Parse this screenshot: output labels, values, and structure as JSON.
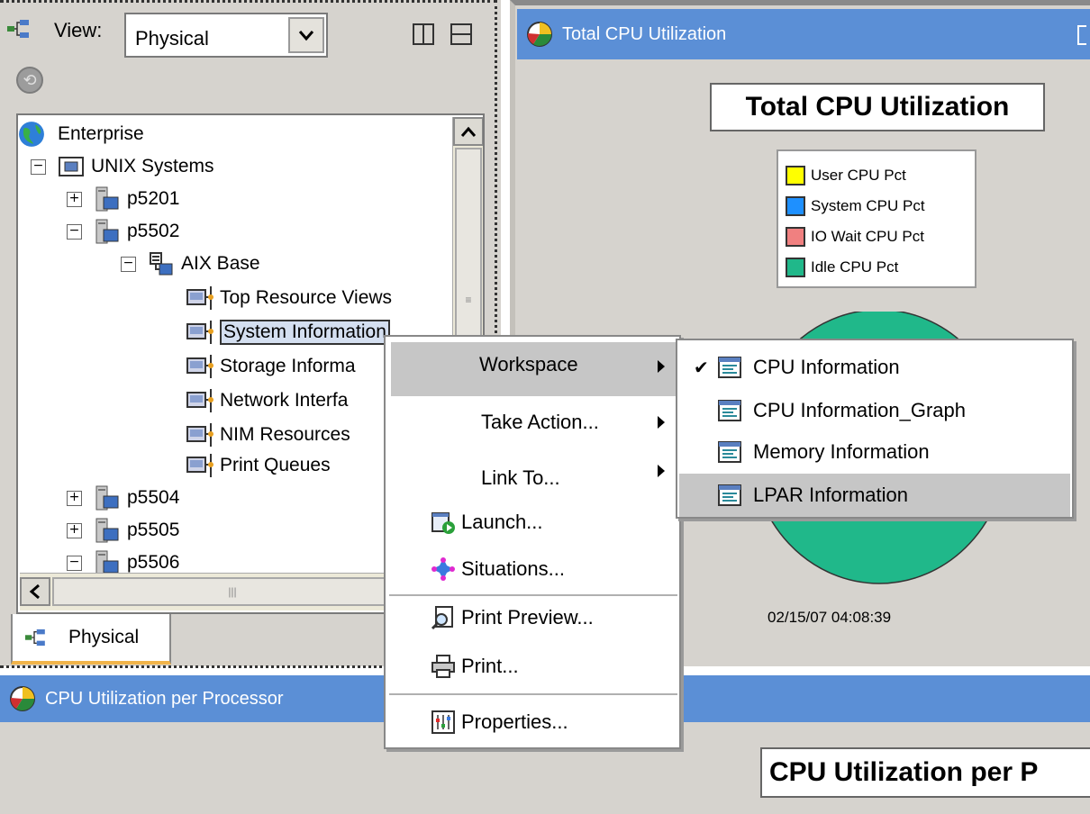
{
  "navigator": {
    "view_label": "View:",
    "view_select_value": "Physical",
    "tree": [
      {
        "label": "Enterprise",
        "icon": "globe-icon"
      },
      {
        "label": "UNIX Systems",
        "icon": "folder-icon",
        "expander": "⊟"
      },
      {
        "label": "p5201",
        "icon": "server-icon",
        "expander": "⊞"
      },
      {
        "label": "p5502",
        "icon": "server-icon",
        "expander": "⊟"
      },
      {
        "label": "AIX Base",
        "icon": "agent-icon",
        "expander": "⊟"
      },
      {
        "label": "Top Resource Views",
        "icon": "workspace-node-icon"
      },
      {
        "label": "System Information",
        "icon": "workspace-node-icon"
      },
      {
        "label": "Storage Informa",
        "icon": "workspace-node-icon"
      },
      {
        "label": "Network Interfa",
        "icon": "workspace-node-icon"
      },
      {
        "label": "NIM Resources",
        "icon": "workspace-node-icon"
      },
      {
        "label": "Print Queues",
        "icon": "workspace-node-icon"
      },
      {
        "label": "p5504",
        "icon": "server-icon",
        "expander": "⊞"
      },
      {
        "label": "p5505",
        "icon": "server-icon",
        "expander": "⊞"
      },
      {
        "label": "p5506",
        "icon": "server-icon",
        "expander": "⊟"
      }
    ],
    "tab_label": "Physical"
  },
  "view_total_cpu": {
    "title_bar": "Total CPU Utilization",
    "chart_title": "Total CPU Utilization",
    "legend": [
      {
        "label": "User CPU Pct",
        "color": "#ffff00"
      },
      {
        "label": "System CPU Pct",
        "color": "#1e90ff"
      },
      {
        "label": "IO Wait CPU Pct",
        "color": "#f08080"
      },
      {
        "label": "Idle CPU Pct",
        "color": "#20b88a"
      }
    ],
    "timestamp": "02/15/07 04:08:39"
  },
  "view_per_processor": {
    "title_bar": "CPU Utilization per Processor",
    "chart_title": "CPU Utilization per P"
  },
  "context_menu": {
    "items": [
      {
        "label": "Workspace",
        "submenu": true,
        "highlighted": true
      },
      {
        "label": "Take Action...",
        "submenu": true
      },
      {
        "label": "Link To...",
        "submenu": true
      },
      {
        "label": "Launch...",
        "icon": "launch-icon"
      },
      {
        "label": "Situations...",
        "icon": "situations-icon"
      },
      {
        "label": "Print Preview...",
        "icon": "print-preview-icon"
      },
      {
        "label": "Print...",
        "icon": "printer-icon"
      },
      {
        "label": "Properties...",
        "icon": "properties-icon"
      }
    ]
  },
  "workspace_submenu": {
    "items": [
      {
        "label": "CPU Information",
        "checked": true
      },
      {
        "label": "CPU Information_Graph"
      },
      {
        "label": "Memory Information"
      },
      {
        "label": "LPAR Information",
        "highlighted": true
      }
    ]
  },
  "colors": {
    "title_bar": "#5b8fd6",
    "panel_bg": "#d6d3ce",
    "menu_highlight": "#c6c6c6"
  }
}
